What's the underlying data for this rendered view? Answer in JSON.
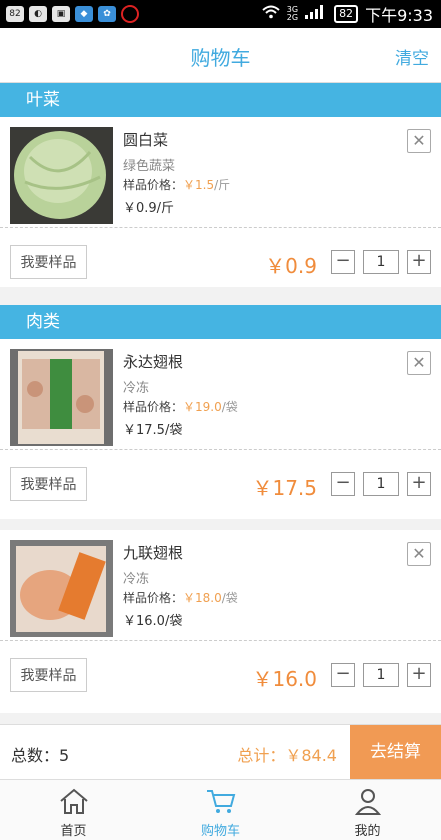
{
  "statusbar": {
    "badge": "82",
    "net_top": "3G",
    "net_bottom": "2G",
    "battery": "82",
    "time": "下午9:33"
  },
  "header": {
    "title": "购物车",
    "clear_label": "清空"
  },
  "sections": [
    {
      "title": "叶菜"
    },
    {
      "title": "肉类"
    }
  ],
  "items": [
    {
      "name": "圆白菜",
      "category": "绿色蔬菜",
      "sample_label": "样品价格：",
      "sample_price": "￥1.5",
      "sample_unit": "/斤",
      "price": "￥0.9/斤",
      "sample_button": "我要样品",
      "subtotal": "￥0.9",
      "quantity": "1"
    },
    {
      "name": "永达翅根",
      "category": "冷冻",
      "sample_label": "样品价格：",
      "sample_price": "￥19.0",
      "sample_unit": "/袋",
      "price": "￥17.5/袋",
      "sample_button": "我要样品",
      "subtotal": "￥17.5",
      "quantity": "1"
    },
    {
      "name": "九联翅根",
      "category": "冷冻",
      "sample_label": "样品价格：",
      "sample_price": "￥18.0",
      "sample_unit": "/袋",
      "price": "￥16.0/袋",
      "sample_button": "我要样品",
      "subtotal": "￥16.0",
      "quantity": "1"
    }
  ],
  "footer": {
    "count_label": "总数：5",
    "total_label": "总计：￥84.4",
    "checkout_label": "去结算"
  },
  "tabs": [
    {
      "label": "首页",
      "icon": "home-icon"
    },
    {
      "label": "购物车",
      "icon": "cart-icon"
    },
    {
      "label": "我的",
      "icon": "user-icon"
    }
  ],
  "colors": {
    "accent": "#41aadf",
    "section": "#45b4e2",
    "price": "#f08c3c",
    "checkout": "#f19a54"
  }
}
